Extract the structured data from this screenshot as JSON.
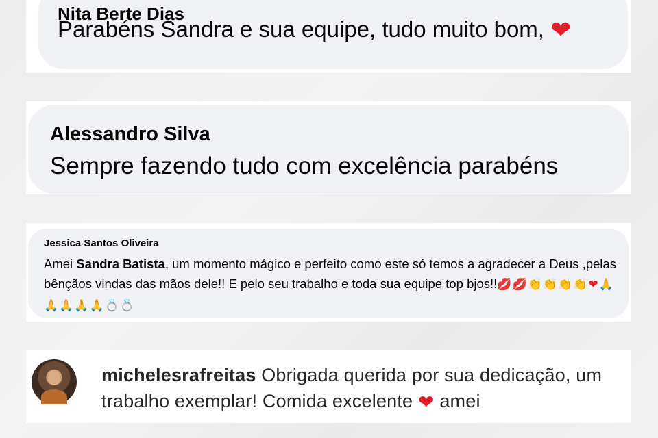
{
  "comments": [
    {
      "author": "Nita Berte Dias",
      "text": "Parabéns Sandra e sua equipe, tudo muito bom,",
      "emoji": "❤"
    },
    {
      "author": "Alessandro Silva",
      "text": "Sempre fazendo tudo com excelência parabéns"
    },
    {
      "author": "Jessica Santos Oliveira",
      "text_before": "Amei ",
      "mention": "Sandra Batista",
      "text_after": ", um momento mágico e perfeito como este só temos a agradecer a Deus ,pelas bênçãos vindas das mãos dele!! E pelo seu trabalho e toda sua equipe top bjos!!",
      "emojis": {
        "kiss": "💋💋",
        "clap": "👏👏👏👏",
        "heart": "❤",
        "pray": "🙏🙏🙏🙏🙏",
        "ring": "💍💍"
      }
    },
    {
      "username": "michelesrafreitas",
      "text_before": "Obrigada querida por sua dedicação, um trabalho exemplar! Comida excelente ",
      "emoji": "❤",
      "text_after": " amei"
    }
  ],
  "icons": [
    "heart-emoji-icon",
    "kiss-emoji-icon",
    "clap-emoji-icon",
    "pray-emoji-icon",
    "ring-emoji-icon"
  ],
  "colors": {
    "bubble": "#f0f2f5",
    "heart": "#e0202a",
    "text": "#050505"
  }
}
